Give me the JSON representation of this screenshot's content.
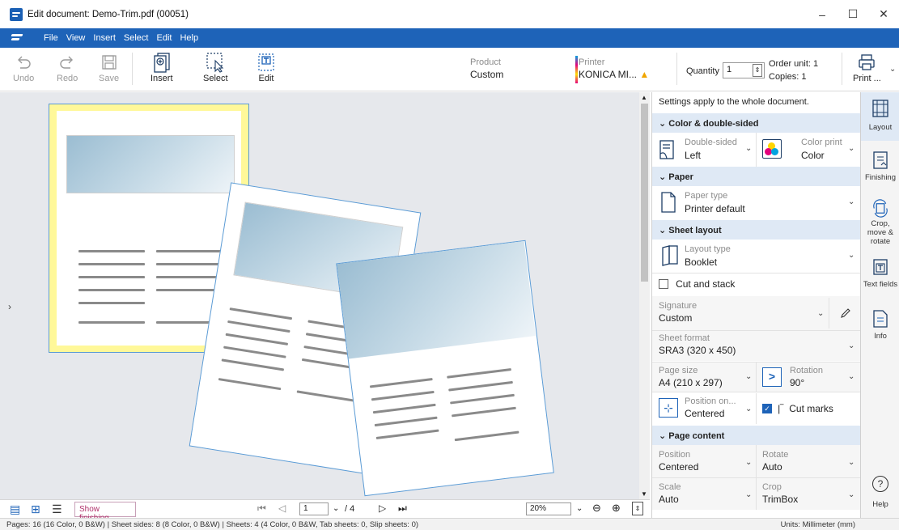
{
  "window": {
    "title": "Edit document: Demo-Trim.pdf (00051)",
    "minimize": "–",
    "maximize": "☐",
    "close": "✕"
  },
  "menu": [
    "File",
    "View",
    "Insert",
    "Select",
    "Edit",
    "Help"
  ],
  "toolbar": {
    "undo": "Undo",
    "redo": "Redo",
    "save": "Save",
    "insert": "Insert",
    "select": "Select",
    "edit": "Edit",
    "product_label": "Product",
    "product_value": "Custom",
    "printer_label": "Printer",
    "printer_value": "KONICA MI...",
    "quantity_label": "Quantity",
    "quantity_value": "1",
    "order_unit": "Order unit: 1",
    "copies": "Copies: 1",
    "print": "Print ..."
  },
  "panel": {
    "note": "Settings apply to the whole document.",
    "sections": {
      "color": "Color & double-sided",
      "paper": "Paper",
      "sheet_layout": "Sheet layout",
      "page_content": "Page content"
    },
    "double_sided_label": "Double-sided",
    "double_sided_value": "Left",
    "color_print_label": "Color print",
    "color_print_value": "Color",
    "paper_type_label": "Paper type",
    "paper_type_value": "Printer default",
    "layout_type_label": "Layout type",
    "layout_type_value": "Booklet",
    "cut_and_stack": "Cut and stack",
    "signature_label": "Signature",
    "signature_value": "Custom",
    "sheet_format_label": "Sheet format",
    "sheet_format_value": "SRA3 (320 x 450)",
    "page_size_label": "Page size",
    "page_size_value": "A4 (210 x 297)",
    "rotation_label": "Rotation",
    "rotation_value": "90°",
    "position_on_label": "Position on...",
    "position_on_value": "Centered",
    "cut_marks": "Cut marks",
    "position_label": "Position",
    "position_value": "Centered",
    "rotate_label": "Rotate",
    "rotate_value": "Auto",
    "scale_label": "Scale",
    "scale_value": "Auto",
    "crop_label": "Crop",
    "crop_value": "TrimBox"
  },
  "tabs": {
    "layout": "Layout",
    "finishing": "Finishing",
    "crop": "Crop, move & rotate",
    "text_fields": "Text fields",
    "info": "Info",
    "help": "Help"
  },
  "bottombar": {
    "show_finishing": "Show finishing",
    "page_current": "1",
    "page_total": "/ 4",
    "zoom": "20%"
  },
  "statusbar": {
    "text": "Pages: 16 (16 Color, 0 B&W) | Sheet sides: 8 (8 Color, 0 B&W) | Sheets: 4 (4 Color, 0 B&W, Tab sheets: 0, Slip sheets: 0)",
    "units": "Units: Millimeter (mm)"
  },
  "colors": {
    "accent": "#1e63b8",
    "section_bg": "#dfe9f5",
    "page_highlight": "#fff899",
    "page_border": "#5b9bd5"
  }
}
